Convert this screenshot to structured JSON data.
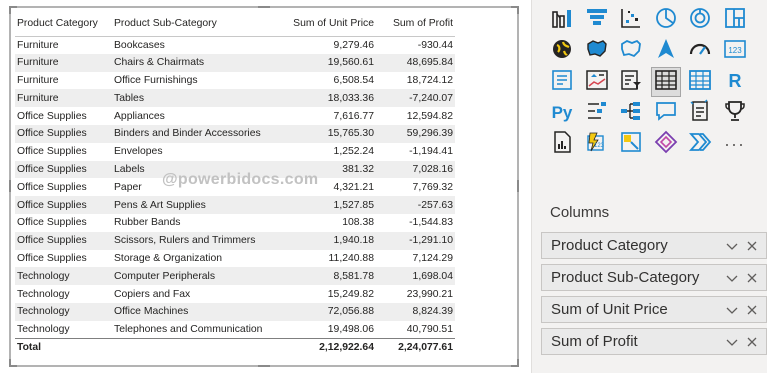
{
  "table": {
    "headers": [
      "Product Category",
      "Product Sub-Category",
      "Sum of Unit Price",
      "Sum of Profit"
    ],
    "rows": [
      [
        "Furniture",
        "Bookcases",
        "9,279.46",
        "-930.44"
      ],
      [
        "Furniture",
        "Chairs & Chairmats",
        "19,560.61",
        "48,695.84"
      ],
      [
        "Furniture",
        "Office Furnishings",
        "6,508.54",
        "18,724.12"
      ],
      [
        "Furniture",
        "Tables",
        "18,033.36",
        "-7,240.07"
      ],
      [
        "Office Supplies",
        "Appliances",
        "7,616.77",
        "12,594.82"
      ],
      [
        "Office Supplies",
        "Binders and Binder Accessories",
        "15,765.30",
        "59,296.39"
      ],
      [
        "Office Supplies",
        "Envelopes",
        "1,252.24",
        "-1,194.41"
      ],
      [
        "Office Supplies",
        "Labels",
        "381.32",
        "7,028.16"
      ],
      [
        "Office Supplies",
        "Paper",
        "4,321.21",
        "7,769.32"
      ],
      [
        "Office Supplies",
        "Pens & Art Supplies",
        "1,527.85",
        "-257.63"
      ],
      [
        "Office Supplies",
        "Rubber Bands",
        "108.38",
        "-1,544.83"
      ],
      [
        "Office Supplies",
        "Scissors, Rulers and Trimmers",
        "1,940.18",
        "-1,291.10"
      ],
      [
        "Office Supplies",
        "Storage & Organization",
        "11,240.88",
        "7,124.29"
      ],
      [
        "Technology",
        "Computer Peripherals",
        "8,581.78",
        "1,698.04"
      ],
      [
        "Technology",
        "Copiers and Fax",
        "15,249.82",
        "23,990.21"
      ],
      [
        "Technology",
        "Office Machines",
        "72,056.88",
        "8,824.39"
      ],
      [
        "Technology",
        "Telephones and Communication",
        "19,498.06",
        "40,790.51"
      ]
    ],
    "total": {
      "label": "Total",
      "unit_price": "2,12,922.64",
      "profit": "2,24,077.61"
    },
    "watermark": "@powerbidocs.com"
  },
  "visualizations": {
    "icons": [
      [
        "ribbon-chart-icon",
        "funnel-icon",
        "scatter-chart-icon",
        "pie-chart-icon",
        "donut-chart-icon",
        "treemap-icon"
      ],
      [
        "map-icon",
        "filled-map-icon",
        "shape-map-icon",
        "azure-map-icon",
        "gauge-icon",
        "card-icon"
      ],
      [
        "multi-row-card-icon",
        "kpi-icon",
        "slicer-icon",
        "table-icon",
        "matrix-icon",
        "r-visual-icon"
      ],
      [
        "python-visual-icon",
        "key-influencers-icon",
        "decomposition-tree-icon",
        "qa-icon",
        "smart-narrative-icon",
        "goals-icon"
      ],
      [
        "paginated-report-icon",
        "power-apps-icon",
        "power-automate-icon",
        "diamond-icon",
        "chevron-visual-icon",
        "more-icon"
      ]
    ],
    "selected": "table-icon",
    "more_label": "···",
    "r_label": "R",
    "card_label": "123",
    "py_label": "Py"
  },
  "columns": {
    "title": "Columns",
    "fields": [
      "Product Category",
      "Product Sub-Category",
      "Sum of Unit Price",
      "Sum of Profit"
    ]
  },
  "colors": {
    "accent": "#1f8ad1",
    "icon_yellow": "#f2c811",
    "icon_dark": "#252423"
  }
}
